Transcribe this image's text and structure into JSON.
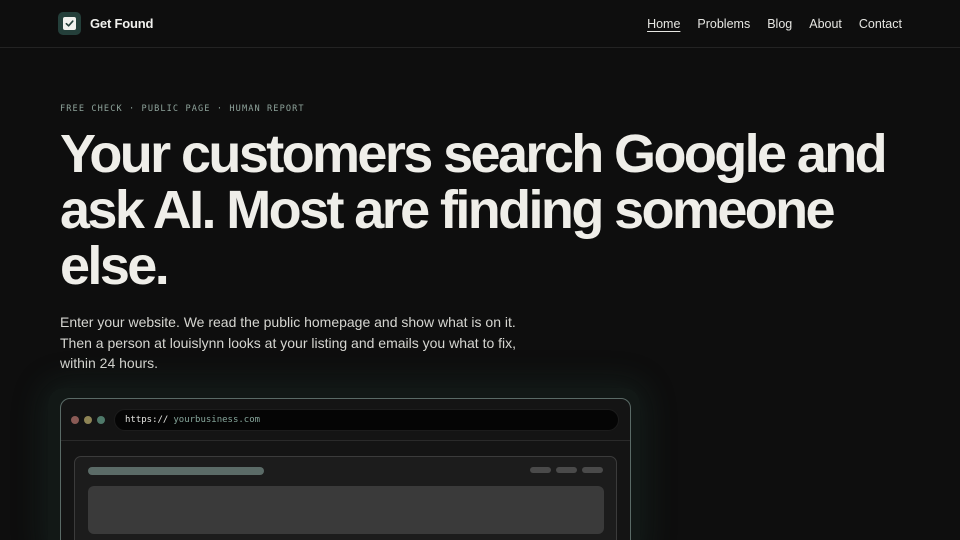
{
  "brand": {
    "name": "Get Found",
    "logo_icon": "check-badge-icon",
    "accent": "#243f3a"
  },
  "nav": {
    "items": [
      {
        "label": "Home",
        "active": true
      },
      {
        "label": "Problems",
        "active": false
      },
      {
        "label": "Blog",
        "active": false
      },
      {
        "label": "About",
        "active": false
      },
      {
        "label": "Contact",
        "active": false
      }
    ]
  },
  "hero": {
    "eyebrow": "FREE CHECK · PUBLIC PAGE · HUMAN REPORT",
    "headline": "Your customers search Google and ask AI. Most are finding someone else.",
    "lede": "Enter your website. We read the public homepage and show what is on it. Then a person at louislynn looks at your listing and emails you what to fix, within 24 hours."
  },
  "browser_mock": {
    "url_scheme": "https://",
    "url_placeholder": "yourbusiness.com"
  }
}
